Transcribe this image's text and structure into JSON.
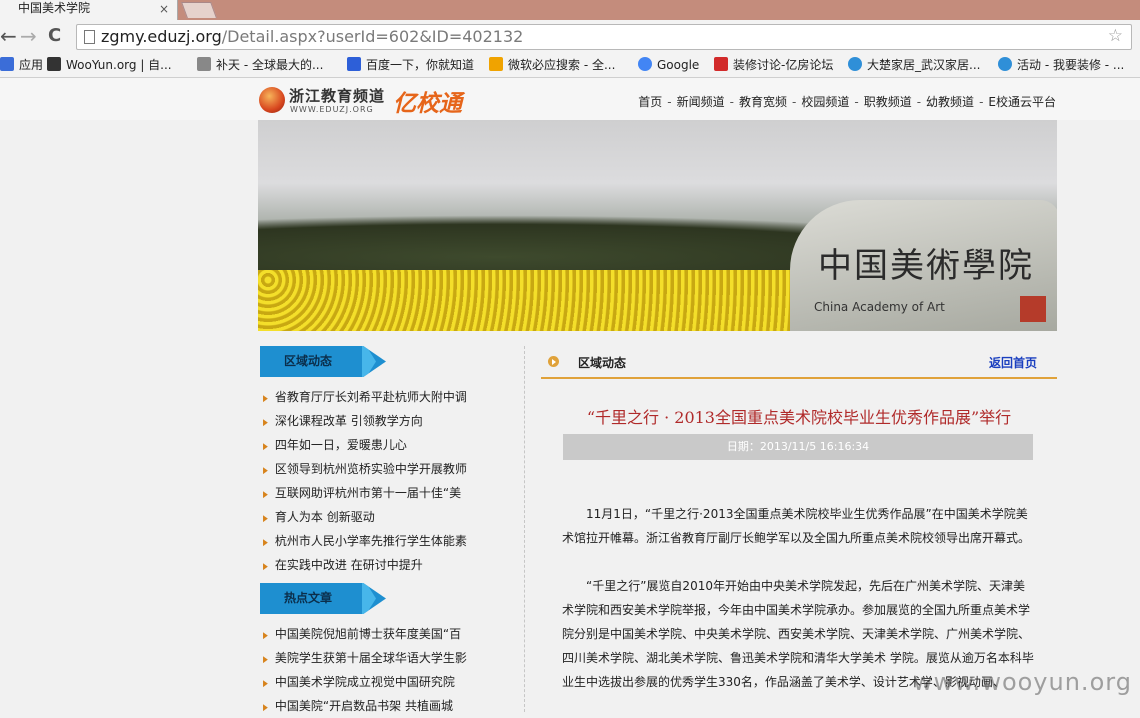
{
  "browser": {
    "tab_title": "中国美术学院",
    "tab_close": "×",
    "url_host": "zgmy.eduzj.org",
    "url_path": "/Detail.aspx?userId=602&ID=402132",
    "back": "←",
    "forward": "→",
    "reload": "C",
    "star": "☆",
    "bookmarks": [
      {
        "label": "应用",
        "color": "#3b6dd8"
      },
      {
        "label": "WooYun.org | 自...",
        "color": "#333333"
      },
      {
        "label": "补天 - 全球最大的...",
        "color": "#777777"
      },
      {
        "label": "百度一下，你就知道",
        "color": "#2d5fd8"
      },
      {
        "label": "微软必应搜索 - 全...",
        "color": "#f0a300"
      },
      {
        "label": "Google",
        "color": "#4285f4"
      },
      {
        "label": "装修讨论-亿房论坛",
        "color": "#d22a2a"
      },
      {
        "label": "大楚家居_武汉家居...",
        "color": "#2f8fd8"
      },
      {
        "label": "活动 - 我要装修 - ...",
        "color": "#2f8fd8"
      }
    ]
  },
  "site": {
    "logo_text": "浙江教育频道",
    "logo_sub": "WWW.EDUZJ.ORG",
    "logo_brand": "亿校通",
    "nav": [
      "首页",
      "新闻频道",
      "教育宽频",
      "校园频道",
      "职教频道",
      "幼教频道",
      "E校通云平台"
    ],
    "nav_sep": "-",
    "banner_carving": "中国美術學院",
    "banner_carving_en": "China Academy of Art"
  },
  "sidebar": {
    "section1_title": "区域动态",
    "section1_items": [
      "省教育厅厅长刘希平赴杭师大附中调",
      "深化课程改革 引领教学方向",
      "四年如一日，爱暖患儿心",
      "区领导到杭州览桥实验中学开展教师",
      "互联网助评杭州市第十一届十佳“美",
      "育人为本 创新驱动",
      "杭州市人民小学率先推行学生体能素",
      "在实践中改进 在研讨中提升"
    ],
    "section2_title": "热点文章",
    "section2_items": [
      "中国美院倪旭前博士获年度美国“百",
      "美院学生获第十届全球华语大学生影",
      "中国美术学院成立视觉中国研究院",
      "中国美院“开启数品书架 共植画城"
    ]
  },
  "article": {
    "section_label": "区域动态",
    "home_link": "返回首页",
    "title": "“千里之行 · 2013全国重点美术院校毕业生优秀作品展”举行",
    "date": "日期：2013/11/5 16:16:34",
    "paragraphs": [
      "11月1日，“千里之行·2013全国重点美术院校毕业生优秀作品展”在中国美术学院美术馆拉开帷幕。浙江省教育厅副厅长鲍学军以及全国九所重点美术院校领导出席开幕式。",
      "“千里之行”展览自2010年开始由中央美术学院发起，先后在广州美术学院、天津美术学院和西安美术学院举报，今年由中国美术学院承办。参加展览的全国九所重点美术学院分别是中国美术学院、中央美术学院、西安美术学院、天津美术学院、广州美术学院、四川美术学院、湖北美术学院、鲁迅美术学院和清华大学美术 学院。展览从逾万名本科毕业生中选拔出参展的优秀学生330名，作品涵盖了美术学、设计艺术学、影视动画、"
    ]
  },
  "watermark": "www.wooyun.org"
}
